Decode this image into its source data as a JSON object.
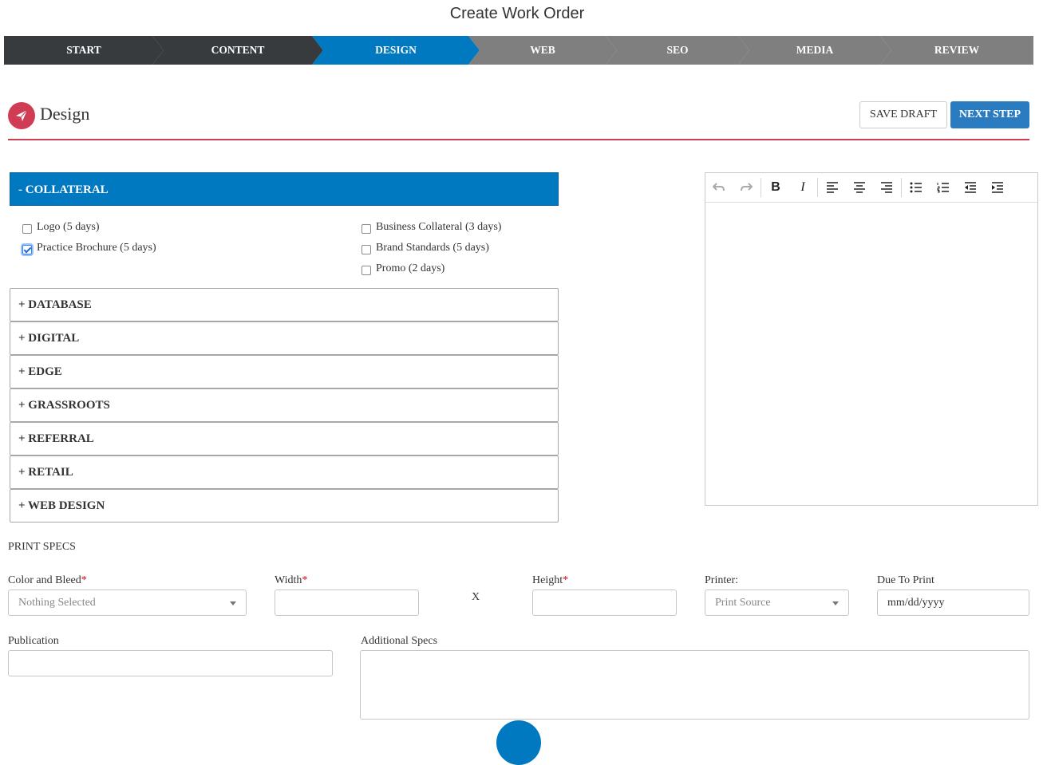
{
  "page_title": "Create Work Order",
  "steps": [
    {
      "label": "START",
      "state": "done"
    },
    {
      "label": "CONTENT",
      "state": "done"
    },
    {
      "label": "DESIGN",
      "state": "active"
    },
    {
      "label": "WEB",
      "state": "todo"
    },
    {
      "label": "SEO",
      "state": "todo"
    },
    {
      "label": "MEDIA",
      "state": "todo"
    },
    {
      "label": "REVIEW",
      "state": "todo"
    }
  ],
  "section": {
    "title": "Design",
    "icon": "paper-plane-icon",
    "save_draft_label": "SAVE DRAFT",
    "next_step_label": "NEXT STEP"
  },
  "colors": {
    "accent": "#0179c1",
    "brand": "#d13c55",
    "done_step": "#373b3e",
    "todo_step": "#7f7f7f"
  },
  "collateral": {
    "header": "- COLLATERAL",
    "left_items": [
      {
        "label": "Logo (5 days)",
        "checked": false
      },
      {
        "label": "Practice Brochure (5 days)",
        "checked": true
      }
    ],
    "right_items": [
      {
        "label": "Business Collateral (3 days)",
        "checked": false
      },
      {
        "label": "Brand Standards (5 days)",
        "checked": false
      },
      {
        "label": "Promo (2 days)",
        "checked": false
      }
    ]
  },
  "categories": [
    "+ DATABASE",
    "+ DIGITAL",
    "+ EDGE",
    "+ GRASSROOTS",
    "+ REFERRAL",
    "+ RETAIL",
    "+ WEB DESIGN"
  ],
  "editor_toolbar": [
    "undo-icon",
    "redo-icon",
    "bold-icon",
    "italic-icon",
    "align-left-icon",
    "align-center-icon",
    "align-right-icon",
    "bullet-list-icon",
    "numbered-list-icon",
    "outdent-icon",
    "indent-icon"
  ],
  "print_specs": {
    "heading": "PRINT SPECS",
    "color_bleed_label": "Color and Bleed",
    "color_bleed_value": "Nothing Selected",
    "width_label": "Width",
    "x_label": "X",
    "height_label": "Height",
    "printer_label": "Printer:",
    "printer_value": "Print Source",
    "due_label": "Due To Print",
    "due_placeholder": "mm/dd/yyyy",
    "required_mark": "*",
    "publication_label": "Publication",
    "additional_label": "Additional Specs"
  }
}
